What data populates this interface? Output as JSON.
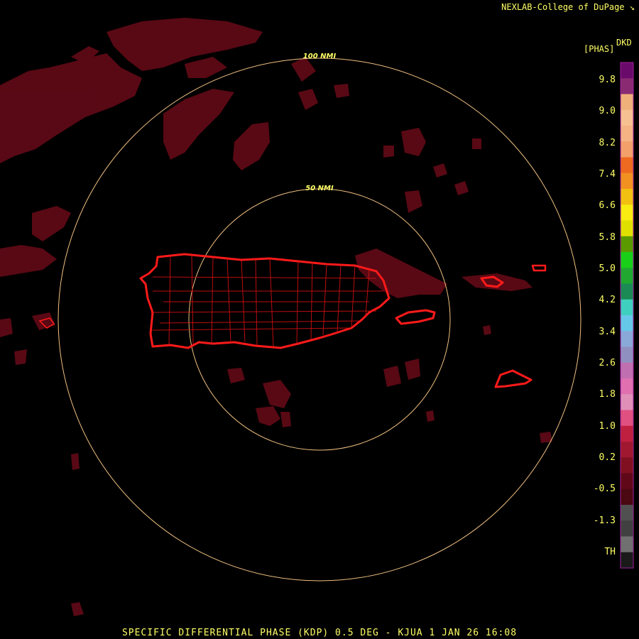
{
  "credit": "NEXLAB-College of DuPage",
  "credit_icon": "corner-arrow-icon",
  "legend": {
    "product_code": "DKD",
    "unit": "[PHAS]",
    "ticks": [
      "9.8",
      "9.0",
      "8.2",
      "7.4",
      "6.6",
      "5.8",
      "5.0",
      "4.2",
      "3.4",
      "2.6",
      "1.8",
      "1.0",
      "0.2",
      "-0.5",
      "-1.3",
      "TH"
    ],
    "colors": [
      "#6a0a6a",
      "#8a2a72",
      "#f0b07a",
      "#f7c090",
      "#f5b384",
      "#f3a06a",
      "#ee6a20",
      "#f29020",
      "#f2c010",
      "#f8ec10",
      "#e0e000",
      "#5a9a00",
      "#18d018",
      "#20a830",
      "#1c8a54",
      "#40d0c0",
      "#66c8e8",
      "#8aa8d8",
      "#9090c0",
      "#c070b0",
      "#e070b0",
      "#e090b8",
      "#e05080",
      "#c02040",
      "#a01830",
      "#801020",
      "#600818",
      "#4a0810",
      "#505050",
      "#404040",
      "#707070",
      "#1a1a1a"
    ]
  },
  "rings": [
    {
      "label": "50 NMI",
      "range_nmi": 50
    },
    {
      "label": "100 NMI",
      "range_nmi": 100
    }
  ],
  "title": "SPECIFIC DIFFERENTIAL PHASE (KDP) 0.5 DEG - KJUA 1 JAN 26 16:08",
  "colors": {
    "text": "#ffff66",
    "ring": "#f0c080",
    "outline": "#ff1a1a",
    "echo": "#6a0a18"
  }
}
